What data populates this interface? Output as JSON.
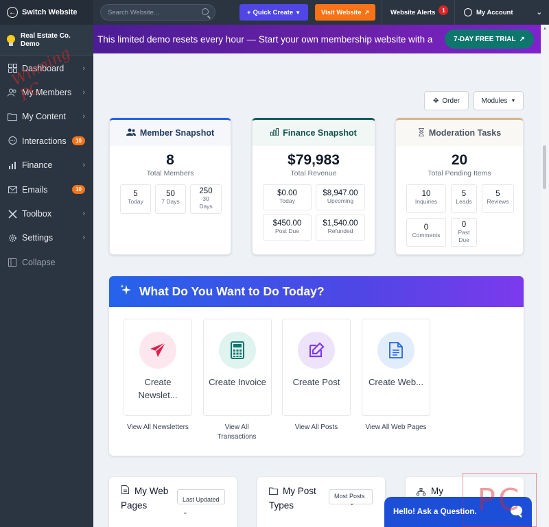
{
  "sidebar": {
    "switch_label": "Switch Website",
    "site_name_line1": "Real Estate Co.",
    "site_name_line2": "Demo",
    "watermark": "Winning PC",
    "items": [
      {
        "label": "Dashboard",
        "icon": "dashboard-icon"
      },
      {
        "label": "My Members",
        "icon": "members-icon"
      },
      {
        "label": "My Content",
        "icon": "folder-icon"
      },
      {
        "label": "Interactions",
        "icon": "chat-icon",
        "badge": "10"
      },
      {
        "label": "Finance",
        "icon": "bar-chart-icon"
      },
      {
        "label": "Emails",
        "icon": "mail-icon",
        "badge": "10"
      },
      {
        "label": "Toolbox",
        "icon": "tools-icon"
      },
      {
        "label": "Settings",
        "icon": "gear-icon"
      }
    ],
    "collapse_label": "Collapse"
  },
  "topbar": {
    "search_placeholder": "Search Website...",
    "quick_create": "Quick Create",
    "visit_website": "Visit Website",
    "alerts_label": "Website Alerts",
    "alerts_count": "1",
    "account_label": "My Account"
  },
  "banner": {
    "text": "This limited demo resets every hour — Start your own membership website with a",
    "trial_button": "7-DAY FREE TRIAL"
  },
  "controls": {
    "order": "Order",
    "modules": "Modules"
  },
  "member_snapshot": {
    "title": "Member Snapshot",
    "total": "8",
    "total_label": "Total Members",
    "stats": [
      {
        "value": "5",
        "label": "Today"
      },
      {
        "value": "50",
        "label": "7 Days"
      },
      {
        "value": "250",
        "label": "30 Days"
      }
    ],
    "accent": "#2563eb"
  },
  "finance_snapshot": {
    "title": "Finance Snapshot",
    "total": "$79,983",
    "total_label": "Total Revenue",
    "stats": [
      {
        "value": "$0.00",
        "label": "Today"
      },
      {
        "value": "$8,947.00",
        "label": "Upcoming"
      },
      {
        "value": "$450.00",
        "label": "Post Due"
      },
      {
        "value": "$1,540.00",
        "label": "Refunded"
      }
    ],
    "accent": "#115e59"
  },
  "moderation": {
    "title": "Moderation Tasks",
    "total": "20",
    "total_label": "Total Pending Items",
    "stats": [
      {
        "value": "10",
        "label": "Inquiries"
      },
      {
        "value": "5",
        "label": "Leads"
      },
      {
        "value": "5",
        "label": "Reviews"
      },
      {
        "value": "0",
        "label": "Comments"
      },
      {
        "value": "0",
        "label": "Past Due"
      }
    ],
    "accent": "#d6b58f"
  },
  "todo": {
    "title": "What Do You Want to Do Today?",
    "actions": [
      {
        "label": "Create Newslet...",
        "link": "View All Newsletters",
        "icon": "paper-plane-icon",
        "color": "#e11d48",
        "bg": "#fde7ef"
      },
      {
        "label": "Create Invoice",
        "link": "View All Transactions",
        "icon": "calculator-icon",
        "color": "#0f766e",
        "bg": "#dff3ef"
      },
      {
        "label": "Create Post",
        "link": "View All Posts",
        "icon": "edit-icon",
        "color": "#7c3aed",
        "bg": "#ede4fb"
      },
      {
        "label": "Create Web...",
        "link": "View All Web Pages",
        "icon": "document-icon",
        "color": "#2563eb",
        "bg": "#e2edfb"
      }
    ]
  },
  "bottom": {
    "web_pages": {
      "title_line1": "My Web",
      "title_line2": "Pages",
      "select": "Last Updated"
    },
    "post_types": {
      "title_line1": "My Post",
      "title_line2": "Types",
      "select": "Most Posts"
    },
    "third": {
      "title": "My"
    }
  },
  "chat": {
    "label": "Hello! Ask a Question."
  },
  "watermark_pc": "PC"
}
